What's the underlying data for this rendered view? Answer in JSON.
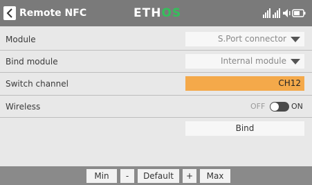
{
  "header": {
    "title": "Remote NFC",
    "logo_main": "ETH",
    "logo_accent": "OS",
    "back_icon": "chevron-left-icon",
    "status_icons": [
      "rssi-icon",
      "signal-icon",
      "volume-icon",
      "battery-icon"
    ]
  },
  "rows": [
    {
      "label": "Module",
      "value": "S.Port connector"
    },
    {
      "label": "Bind module",
      "value": "Internal module"
    },
    {
      "label": "Switch channel",
      "value": "CH12"
    },
    {
      "label": "Wireless",
      "off_label": "OFF",
      "on_label": "ON",
      "state": "on"
    }
  ],
  "bind_label": "Bind",
  "bottom_bar": {
    "min": "Min",
    "minus": "-",
    "default": "Default",
    "plus": "+",
    "max": "Max"
  },
  "colors": {
    "accent": "#f4a94a",
    "header_bg": "#7a7a7a",
    "logo_accent": "#33c05a"
  }
}
